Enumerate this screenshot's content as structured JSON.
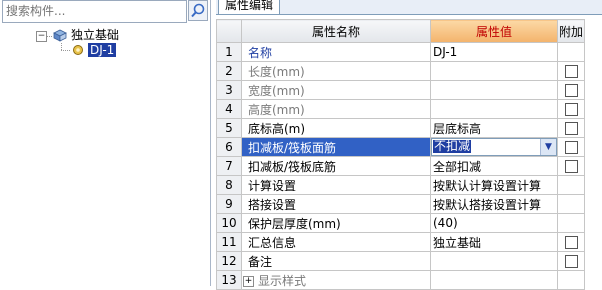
{
  "search": {
    "placeholder": "搜索构件..."
  },
  "tree": {
    "root_label": "独立基础",
    "root_expander": "⊟",
    "child_label": "DJ-1"
  },
  "panel": {
    "tab_label": "属性编辑"
  },
  "table": {
    "headers": {
      "name": "属性名称",
      "value": "属性值",
      "extra": "附加"
    },
    "rows": [
      {
        "num": "1",
        "name": "名称",
        "value": "DJ-1",
        "style": "blue",
        "checkbox": false
      },
      {
        "num": "2",
        "name": "长度(mm)",
        "value": "",
        "style": "grey",
        "checkbox": true
      },
      {
        "num": "3",
        "name": "宽度(mm)",
        "value": "",
        "style": "grey",
        "checkbox": true
      },
      {
        "num": "4",
        "name": "高度(mm)",
        "value": "",
        "style": "grey",
        "checkbox": true
      },
      {
        "num": "5",
        "name": "底标高(m)",
        "value": "层底标高",
        "style": "normal",
        "checkbox": true
      },
      {
        "num": "6",
        "name": "扣减板/筏板面筋",
        "value": "不扣减",
        "style": "selected",
        "checkbox": true
      },
      {
        "num": "7",
        "name": "扣减板/筏板底筋",
        "value": "全部扣减",
        "style": "normal",
        "checkbox": true
      },
      {
        "num": "8",
        "name": "计算设置",
        "value": "按默认计算设置计算",
        "style": "normal",
        "checkbox": false
      },
      {
        "num": "9",
        "name": "搭接设置",
        "value": "按默认搭接设置计算",
        "style": "normal",
        "checkbox": false
      },
      {
        "num": "10",
        "name": "保护层厚度(mm)",
        "value": "(40)",
        "style": "normal",
        "checkbox": false
      },
      {
        "num": "11",
        "name": "汇总信息",
        "value": "独立基础",
        "style": "normal",
        "checkbox": true
      },
      {
        "num": "12",
        "name": "备注",
        "value": "",
        "style": "normal",
        "checkbox": true
      },
      {
        "num": "13",
        "name": "显示样式",
        "value": "",
        "style": "grey-expand",
        "checkbox": false
      }
    ],
    "expand_symbol": "+"
  },
  "icons": [
    "search-icon",
    "foundation-group-icon",
    "component-icon",
    "dropdown-arrow-icon"
  ],
  "colors": {
    "selection": "#3161c5",
    "value_header": "#f3b36c",
    "value_header_text": "#c00000",
    "link_blue": "#1f3ea2"
  }
}
